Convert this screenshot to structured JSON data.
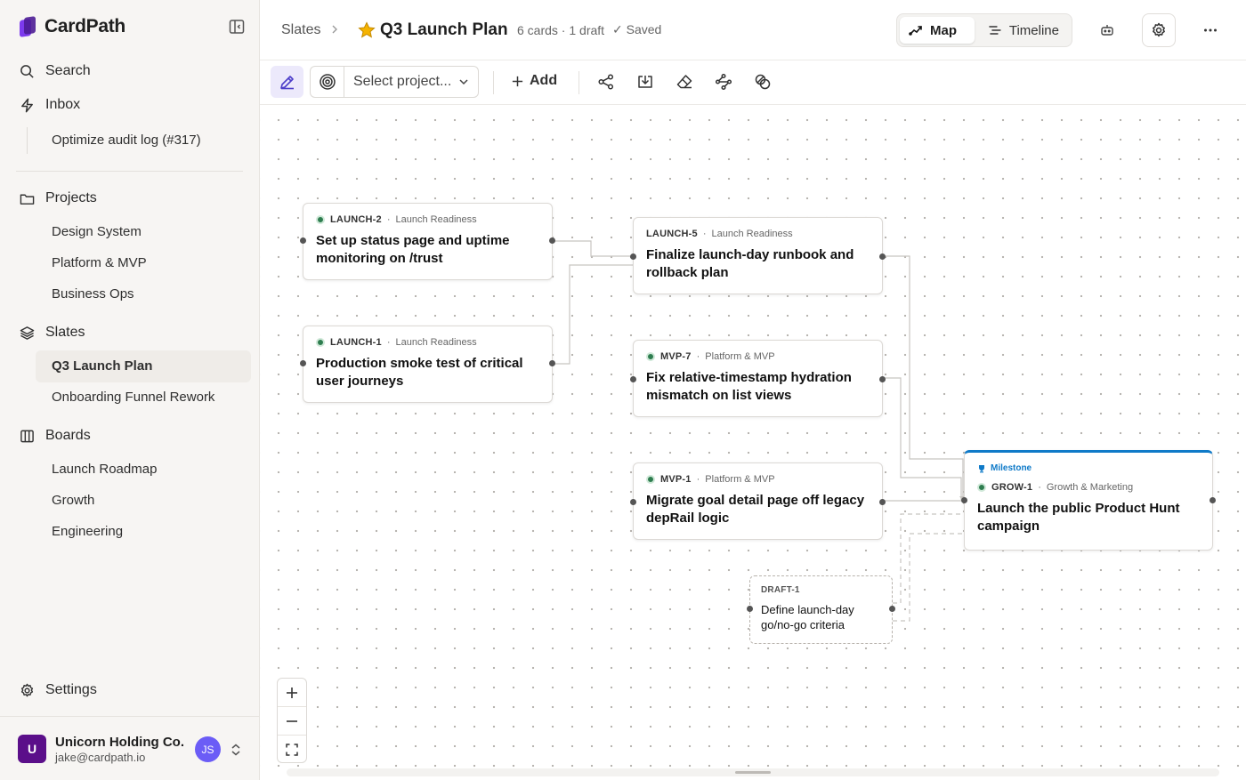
{
  "app": {
    "name": "CardPath"
  },
  "sidebar": {
    "search": "Search",
    "inbox": "Inbox",
    "inbox_items": [
      "Optimize audit log (#317)"
    ],
    "projects": {
      "label": "Projects",
      "items": [
        "Design System",
        "Platform & MVP",
        "Business Ops"
      ]
    },
    "slates": {
      "label": "Slates",
      "items": [
        "Q3 Launch Plan",
        "Onboarding Funnel Rework"
      ],
      "active": "Q3 Launch Plan"
    },
    "boards": {
      "label": "Boards",
      "items": [
        "Launch Roadmap",
        "Growth",
        "Engineering"
      ]
    },
    "settings": "Settings",
    "org": {
      "avatar": "U",
      "name": "Unicorn Holding Co.",
      "email": "jake@cardpath.io",
      "user_initials": "JS"
    }
  },
  "header": {
    "breadcrumb": "Slates",
    "title": "Q3 Launch Plan",
    "meta": "6 cards · 1 draft",
    "status": "✓ Saved",
    "views": {
      "map": "Map",
      "timeline": "Timeline",
      "selected": "Map"
    }
  },
  "toolbar": {
    "project_select": "Select project...",
    "add": "Add"
  },
  "cards": [
    {
      "id": "launch2",
      "key": "LAUNCH-2",
      "project": "Launch Readiness",
      "status_dot": true,
      "title": "Set up status page and uptime monitoring on /trust"
    },
    {
      "id": "launch1",
      "key": "LAUNCH-1",
      "project": "Launch Readiness",
      "status_dot": true,
      "title": "Production smoke test of critical user journeys"
    },
    {
      "id": "launch5",
      "key": "LAUNCH-5",
      "project": "Launch Readiness",
      "status_dot": false,
      "title": "Finalize launch-day runbook and rollback plan"
    },
    {
      "id": "mvp7",
      "key": "MVP-7",
      "project": "Platform & MVP",
      "status_dot": true,
      "title": "Fix relative-timestamp hydration mismatch on list views"
    },
    {
      "id": "mvp1",
      "key": "MVP-1",
      "project": "Platform & MVP",
      "status_dot": true,
      "title": "Migrate goal detail page off legacy depRail logic"
    },
    {
      "id": "grow1",
      "key": "GROW-1",
      "project": "Growth & Marketing",
      "status_dot": true,
      "milestone": "Milestone",
      "title": "Launch the public Product Hunt campaign"
    }
  ],
  "draft": {
    "key": "DRAFT-1",
    "title": "Define launch-day go/no-go criteria"
  },
  "colors": {
    "accent": "#7c3aed",
    "milestone": "#0f7ac8",
    "status_green": "#2e7d4f",
    "org_avatar": "#5b0f8a",
    "user_avatar": "#6b5cf6"
  }
}
